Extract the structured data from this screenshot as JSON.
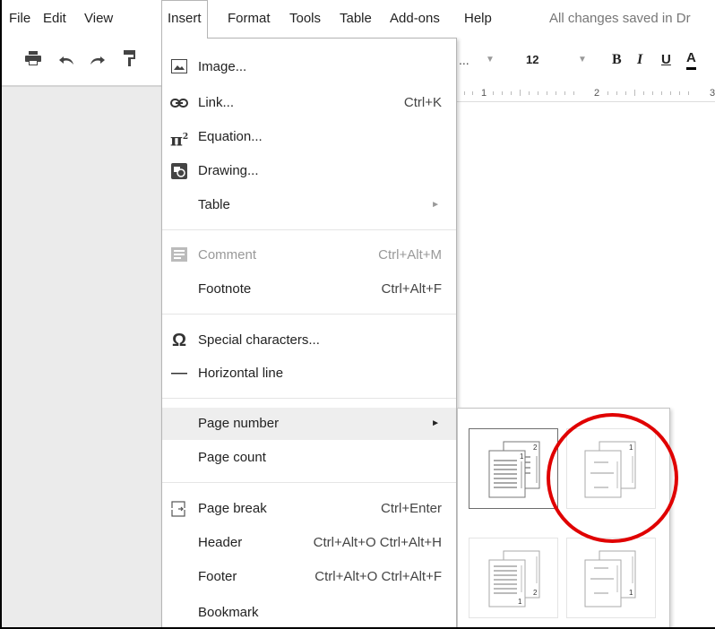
{
  "menubar": {
    "items": [
      "File",
      "Edit",
      "View",
      "Insert",
      "Format",
      "Tools",
      "Table",
      "Add-ons",
      "Help"
    ],
    "status": "All changes saved in Dr"
  },
  "toolbar": {
    "font_ellipsis": "...",
    "font_size": "12",
    "bold": "B",
    "italic": "I",
    "underline": "U",
    "text_color": "A"
  },
  "ruler": {
    "labels": [
      "1",
      "2",
      "3"
    ]
  },
  "insert_menu": {
    "items": [
      {
        "label": "Image...",
        "icon": "image-icon"
      },
      {
        "label": "Link...",
        "shortcut": "Ctrl+K",
        "icon": "link-icon"
      },
      {
        "label": "Equation...",
        "icon": "equation-icon"
      },
      {
        "label": "Drawing...",
        "icon": "drawing-icon"
      },
      {
        "label": "Table",
        "submenu": true
      },
      {
        "label": "Comment",
        "shortcut": "Ctrl+Alt+M",
        "icon": "comment-icon",
        "disabled": true
      },
      {
        "label": "Footnote",
        "shortcut": "Ctrl+Alt+F"
      },
      {
        "label": "Special characters...",
        "icon": "omega-icon"
      },
      {
        "label": "Horizontal line",
        "icon": "horizontal-line-icon"
      },
      {
        "label": "Page number",
        "submenu": true,
        "hover": true
      },
      {
        "label": "Page count"
      },
      {
        "label": "Page break",
        "shortcut": "Ctrl+Enter",
        "icon": "page-break-icon"
      },
      {
        "label": "Header",
        "shortcut": "Ctrl+Alt+O Ctrl+Alt+H"
      },
      {
        "label": "Footer",
        "shortcut": "Ctrl+Alt+O Ctrl+Alt+F"
      },
      {
        "label": "Bookmark"
      }
    ]
  },
  "page_number_submenu": {
    "options": [
      {
        "number": "1",
        "second_page_number": "2",
        "position": "top"
      },
      {
        "number": "1",
        "position": "top"
      },
      {
        "number": "1",
        "second_page_number": "2",
        "position": "bottom"
      },
      {
        "number": "1",
        "position": "bottom"
      }
    ],
    "highlight_color": "#e00000"
  }
}
